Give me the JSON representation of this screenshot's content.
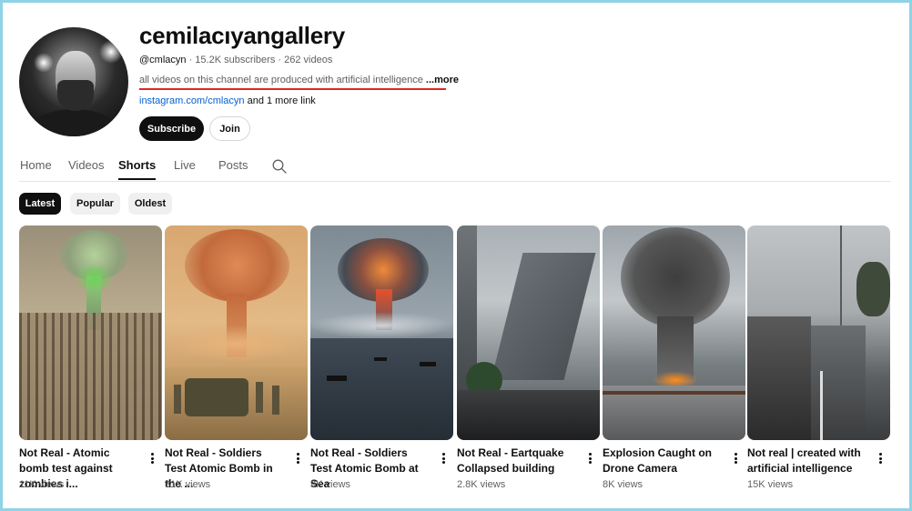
{
  "channel": {
    "name": "cemilacıyangallery",
    "handle": "@cmlacyn",
    "stats": " · 15.2K subscribers · 262 videos",
    "description": "all videos on this channel are produced with artificial intelligence",
    "more_label": " ...more",
    "link_primary": "instagram.com/cmlacyn",
    "link_extra": " and 1 more link",
    "subscribe_label": "Subscribe",
    "join_label": "Join"
  },
  "tabs": [
    {
      "label": "Home"
    },
    {
      "label": "Videos"
    },
    {
      "label": "Shorts",
      "active": true
    },
    {
      "label": "Live"
    },
    {
      "label": "Posts"
    }
  ],
  "chips": [
    {
      "label": "Latest",
      "active": true
    },
    {
      "label": "Popular"
    },
    {
      "label": "Oldest"
    }
  ],
  "shorts": [
    {
      "title": "Not Real - Atomic bomb test against zombies i...",
      "views": "11K views"
    },
    {
      "title": "Not Real - Soldiers Test Atomic Bomb in the ...",
      "views": "31K views"
    },
    {
      "title": "Not Real - Soldiers Test Atomic Bomb at Sea",
      "views": "9K views"
    },
    {
      "title": "Not Real - Eartquake Collapsed building",
      "views": "2.8K views"
    },
    {
      "title": "Explosion Caught on Drone Camera",
      "views": "8K views"
    },
    {
      "title": "Not real | created with artificial intelligence",
      "views": "15K views"
    }
  ],
  "colors": {
    "accent_red": "#e0261f",
    "link_blue": "#065fd4",
    "frame": "#8fd3e6"
  }
}
